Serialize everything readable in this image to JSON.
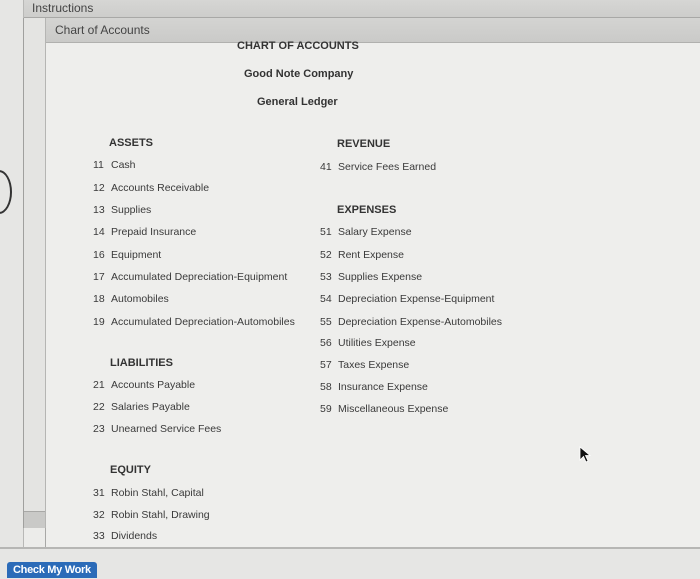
{
  "panels": {
    "instructions_label": "Instructions",
    "chart_tab_label": "Chart of Accounts"
  },
  "header": {
    "title": "CHART OF ACCOUNTS",
    "company": "Good Note Company",
    "ledger": "General Ledger"
  },
  "assets": {
    "heading": "ASSETS",
    "items": [
      {
        "num": "11",
        "name": "Cash"
      },
      {
        "num": "12",
        "name": "Accounts Receivable"
      },
      {
        "num": "13",
        "name": "Supplies"
      },
      {
        "num": "14",
        "name": "Prepaid Insurance"
      },
      {
        "num": "16",
        "name": "Equipment"
      },
      {
        "num": "17",
        "name": "Accumulated Depreciation-Equipment"
      },
      {
        "num": "18",
        "name": "Automobiles"
      },
      {
        "num": "19",
        "name": "Accumulated Depreciation-Automobiles"
      }
    ]
  },
  "liabilities": {
    "heading": "LIABILITIES",
    "items": [
      {
        "num": "21",
        "name": "Accounts Payable"
      },
      {
        "num": "22",
        "name": "Salaries Payable"
      },
      {
        "num": "23",
        "name": "Unearned Service Fees"
      }
    ]
  },
  "equity": {
    "heading": "EQUITY",
    "items": [
      {
        "num": "31",
        "name": "Robin Stahl, Capital"
      },
      {
        "num": "32",
        "name": "Robin Stahl, Drawing"
      },
      {
        "num": "33",
        "name": "Dividends"
      }
    ]
  },
  "revenue": {
    "heading": "REVENUE",
    "items": [
      {
        "num": "41",
        "name": "Service Fees Earned"
      }
    ]
  },
  "expenses": {
    "heading": "EXPENSES",
    "items": [
      {
        "num": "51",
        "name": "Salary Expense"
      },
      {
        "num": "52",
        "name": "Rent Expense"
      },
      {
        "num": "53",
        "name": "Supplies Expense"
      },
      {
        "num": "54",
        "name": "Depreciation Expense-Equipment"
      },
      {
        "num": "55",
        "name": "Depreciation Expense-Automobiles"
      },
      {
        "num": "56",
        "name": "Utilities Expense"
      },
      {
        "num": "57",
        "name": "Taxes Expense"
      },
      {
        "num": "58",
        "name": "Insurance Expense"
      },
      {
        "num": "59",
        "name": "Miscellaneous Expense"
      }
    ]
  },
  "footer": {
    "check_button_label": "Check My Work"
  },
  "colors": {
    "button_bg": "#2b6bb8"
  }
}
